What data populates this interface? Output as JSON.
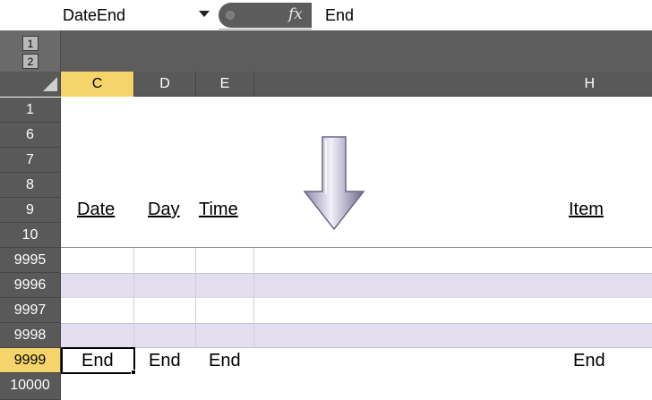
{
  "formula_bar": {
    "name_box": "DateEnd",
    "fx_label": "fx",
    "content": "End"
  },
  "outline_levels": [
    "1",
    "2"
  ],
  "columns": [
    {
      "letter": "C",
      "active": true
    },
    {
      "letter": "D",
      "active": false
    },
    {
      "letter": "E",
      "active": false
    },
    {
      "letter": "H",
      "active": false
    }
  ],
  "rows": [
    "1",
    "6",
    "7",
    "8",
    "9",
    "10",
    "9995",
    "9996",
    "9997",
    "9998",
    "9999",
    "10000"
  ],
  "active_row": "9999",
  "header_labels": {
    "date": "Date",
    "day": "Day",
    "time": "Time",
    "item": "Item"
  },
  "end_row": {
    "c": "End",
    "d": "End",
    "e": "End",
    "h": "End"
  },
  "colors": {
    "header_bg": "#595959",
    "active_header": "#f5d56a",
    "banded_row": "#e3dfee"
  },
  "icons": [
    "fx-icon",
    "dropdown-arrow-icon",
    "select-all-icon",
    "down-arrow-icon"
  ]
}
